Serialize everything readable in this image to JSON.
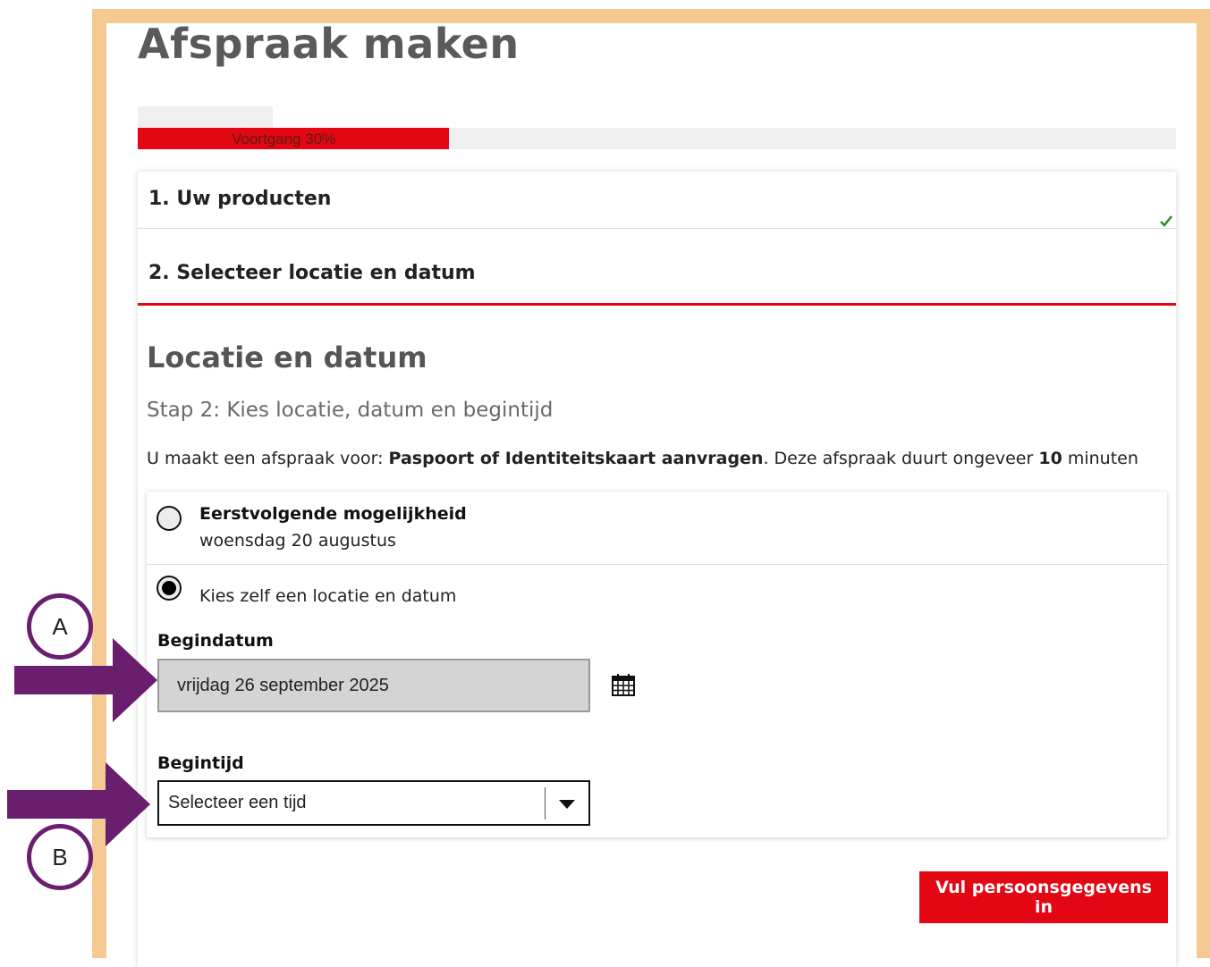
{
  "page": {
    "title": "Afspraak maken"
  },
  "progress": {
    "label": "Voortgang 30%",
    "percent": 30,
    "color": "#e30613"
  },
  "steps": [
    {
      "label": "1. Uw producten",
      "completed": true
    },
    {
      "label": "2. Selecteer locatie en datum",
      "active": true
    }
  ],
  "section": {
    "title": "Locatie en datum",
    "substep": "Stap 2: Kies locatie, datum en begintijd",
    "desc_prefix": "U maakt een afspraak voor: ",
    "product": "Paspoort of Identiteitskaart aanvragen",
    "desc_mid": ". Deze afspraak duurt ongeveer ",
    "duration": "10",
    "desc_suffix": " minuten"
  },
  "options": {
    "first": {
      "title": "Eerstvolgende mogelijkheid",
      "date": "woensdag 20 augustus",
      "selected": false
    },
    "custom": {
      "label": "Kies zelf een locatie en datum",
      "selected": true
    }
  },
  "begindatum": {
    "label": "Begindatum",
    "value": "vrijdag 26 september 2025",
    "icon": "calendar-icon"
  },
  "begintijd": {
    "label": "Begintijd",
    "placeholder": "Selecteer een tijd",
    "icon": "chevron-down-icon"
  },
  "next_button": {
    "label": "Vul persoonsgegevens in"
  },
  "annotations": {
    "marker_a": "A",
    "marker_b": "B",
    "arrow_color": "#6a1e6e"
  },
  "colors": {
    "accent": "#e30613",
    "frame": "#f5c992",
    "check": "#2e8b2e"
  }
}
